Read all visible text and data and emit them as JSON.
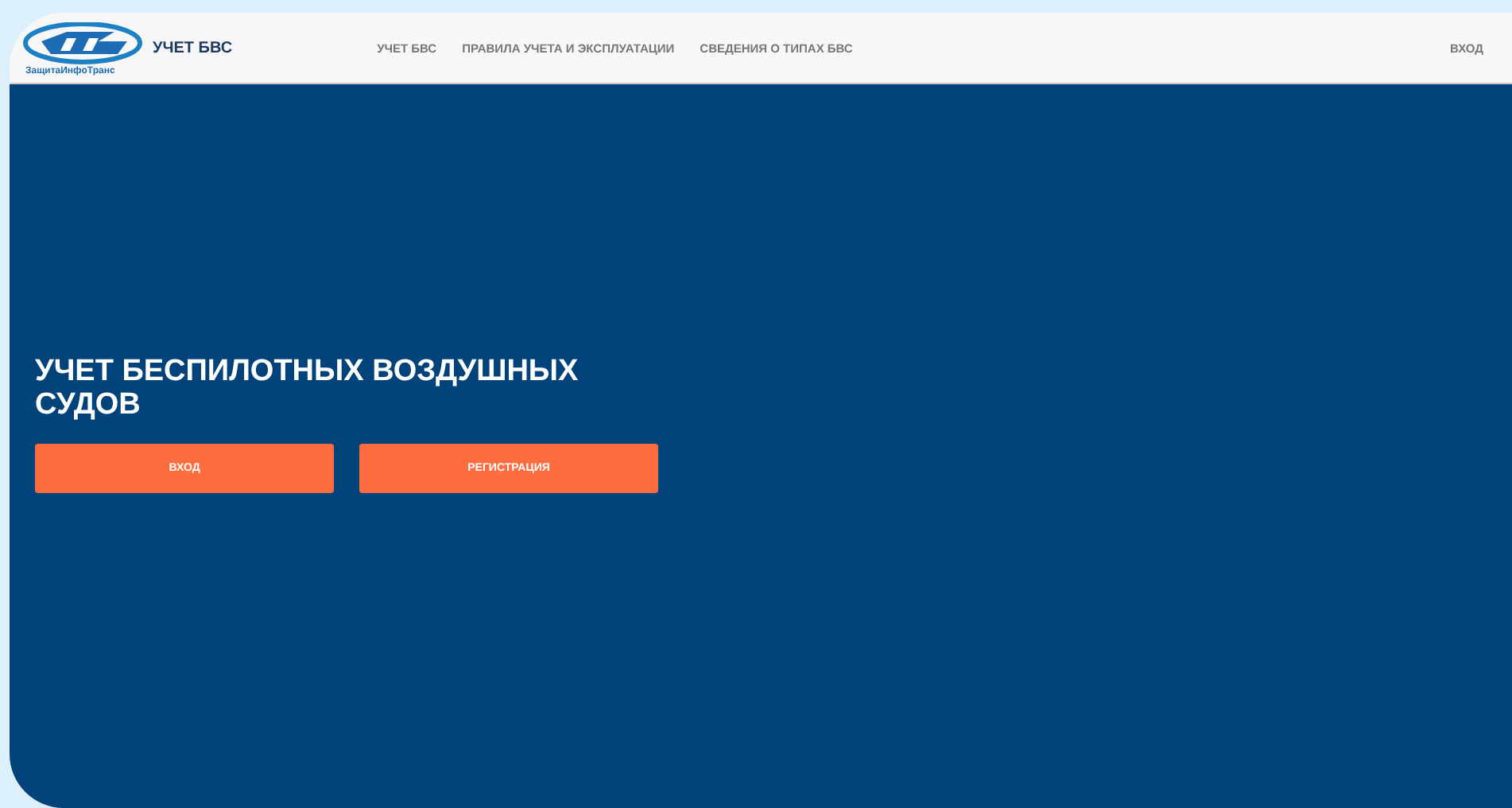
{
  "header": {
    "logo_text": "ЗащитаИнфоТранс",
    "brand": "УЧЕТ БВС",
    "nav": [
      "УЧЕТ БВС",
      "ПРАВИЛА УЧЕТА И ЭКСПЛУАТАЦИИ",
      "СВЕДЕНИЯ О ТИПАХ БВС"
    ],
    "login": "ВХОД"
  },
  "hero": {
    "title": "УЧЕТ БЕСПИЛОТНЫХ ВОЗДУШНЫХ СУДОВ",
    "buttons": [
      "ВХОД",
      "РЕГИСТРАЦИЯ"
    ]
  }
}
